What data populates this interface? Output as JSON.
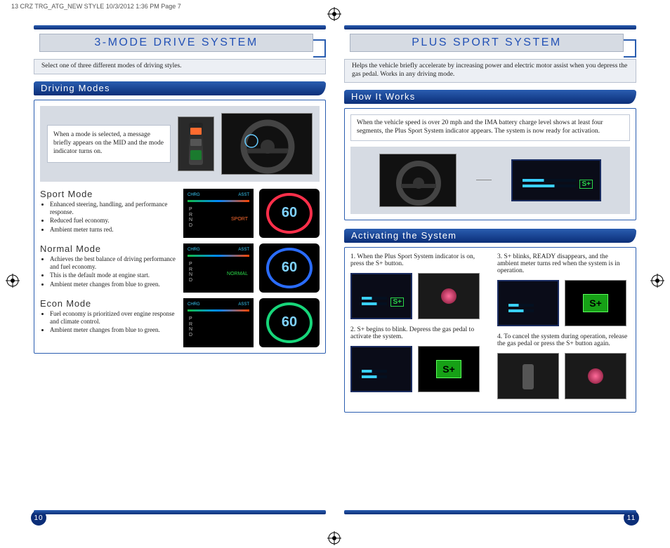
{
  "print_header": "13 CRZ TRG_ATG_NEW STYLE  10/3/2012  1:36 PM  Page 7",
  "left": {
    "title": "3-MODE DRIVE SYSTEM",
    "intro": "Select one of three different modes of driving styles.",
    "section1": "Driving Modes",
    "callout": "When a mode is selected, a message briefly appears on the MID and the mode indicator turns on.",
    "modes": {
      "sport": {
        "title": "Sport Mode",
        "b1": "Enhanced steering, handling, and performance response.",
        "b2": "Reduced fuel economy.",
        "b3": "Ambient meter turns red.",
        "mode_label": "SPORT",
        "speed": "60"
      },
      "normal": {
        "title": "Normal Mode",
        "b1": "Achieves the best balance of driving performance and fuel economy.",
        "b2": "This is the default mode at engine start.",
        "b3": "Ambient meter changes from blue to green.",
        "mode_label": "NORMAL",
        "speed": "60"
      },
      "econ": {
        "title": "Econ Mode",
        "b1": "Fuel economy is prioritized over engine response and climate control.",
        "b2": "Ambient meter changes from blue to green.",
        "mode_label": "",
        "speed": "60"
      }
    },
    "gauge_labels": {
      "chrg": "CHRG",
      "asst": "ASST",
      "prnd": "P\nR\nN\nD"
    },
    "pagenum": "10"
  },
  "right": {
    "title": "PLUS SPORT SYSTEM",
    "intro": "Helps the vehicle briefly accelerate by increasing power and electric motor assist when you depress the gas pedal.  Works in any driving mode.",
    "section1": "How It Works",
    "howit_text": "When the vehicle speed is over 20 mph and the IMA battery charge level shows at least four segments, the Plus Sport System indicator appears.  The system is now ready for activation.",
    "section2": "Activating the System",
    "steps": {
      "s1": "When the Plus Sport System indicator is on, press the S+ button.",
      "s2": "S+ begins to blink. Depress the gas pedal to activate the system.",
      "s3": "S+ blinks, READY disappears, and the ambient meter turns red when the system is in operation.",
      "s4": "To cancel the system during operation, release the gas pedal or press the S+ button again."
    },
    "splus_label": "S+",
    "pagenum": "11"
  }
}
